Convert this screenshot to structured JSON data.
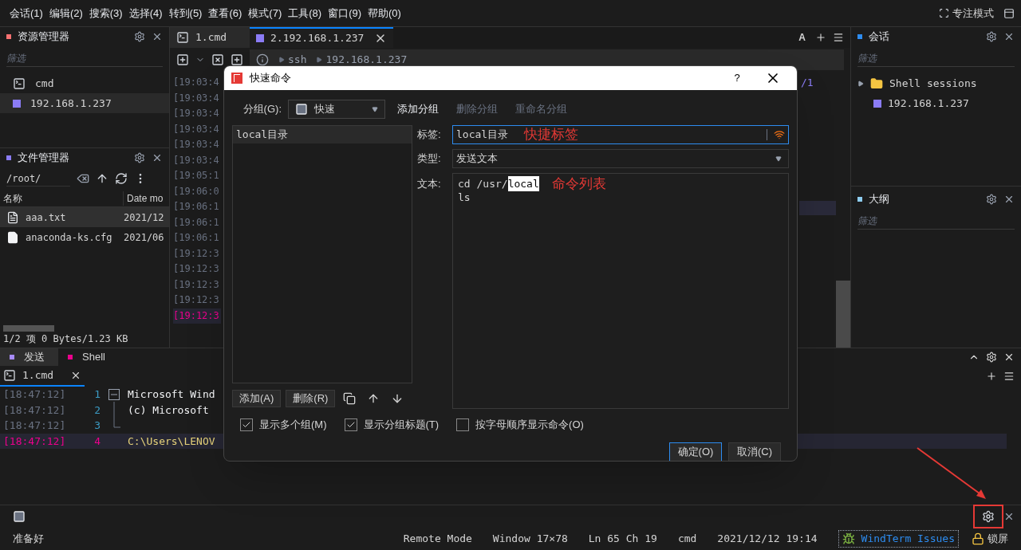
{
  "menu_bar": {
    "items": [
      "会话(1)",
      "编辑(2)",
      "搜索(3)",
      "选择(4)",
      "转到(5)",
      "查看(6)",
      "模式(7)",
      "工具(8)",
      "窗口(9)",
      "帮助(0)"
    ],
    "focus_mode": "专注模式"
  },
  "explorer": {
    "title": "资源管理器",
    "filter_placeholder": "筛选",
    "items": [
      {
        "label": "cmd",
        "kind": "terminal",
        "selected": false
      },
      {
        "label": "192.168.1.237",
        "kind": "ssh",
        "selected": true
      }
    ]
  },
  "file_manager": {
    "title": "文件管理器",
    "path": "/root/",
    "columns": [
      "名称",
      "Date mo"
    ],
    "rows": [
      {
        "name": "aaa.txt",
        "kind": "text",
        "date": "2021/12",
        "selected": true
      },
      {
        "name": "anaconda-ks.cfg",
        "kind": "file",
        "date": "2021/06",
        "selected": false
      }
    ],
    "status": "1/2 项 0 Bytes/1.23 KB"
  },
  "editor_tabs": [
    {
      "label": "1.cmd",
      "kind": "terminal",
      "selected": false
    },
    {
      "label": "2.192.168.1.237",
      "kind": "ssh",
      "selected": true
    }
  ],
  "font_button": "A",
  "breadcrumb": [
    "ssh",
    "192.168.1.237"
  ],
  "terminal_lines": [
    {
      "time": "[19:03:4",
      "highlighted": false
    },
    {
      "time": "[19:03:4",
      "highlighted": false
    },
    {
      "time": "[19:03:4",
      "highlighted": false
    },
    {
      "time": "[19:03:4",
      "highlighted": false
    },
    {
      "time": "[19:03:4",
      "highlighted": false
    },
    {
      "time": "[19:03:4",
      "highlighted": false
    },
    {
      "time": "[19:05:1",
      "highlighted": false
    },
    {
      "time": "[19:06:0",
      "highlighted": false
    },
    {
      "time": "[19:06:1",
      "highlighted": false
    },
    {
      "time": "[19:06:1",
      "highlighted": false
    },
    {
      "time": "[19:06:1",
      "highlighted": false
    },
    {
      "time": "[19:12:3",
      "highlighted": false
    },
    {
      "time": "[19:12:3",
      "highlighted": false
    },
    {
      "time": "[19:12:3",
      "highlighted": false
    },
    {
      "time": "[19:12:3",
      "highlighted": false
    },
    {
      "time": "[19:12:3",
      "highlighted": true
    }
  ],
  "terminal_tail": "/1",
  "sessions": {
    "title": "会话",
    "filter_placeholder": "筛选",
    "items": [
      {
        "label": "Shell sessions",
        "kind": "folder",
        "expanded": false
      },
      {
        "label": "192.168.1.237",
        "kind": "ssh"
      }
    ]
  },
  "outline": {
    "title": "大纲",
    "filter_placeholder": "筛选"
  },
  "bottom_panel": {
    "tabs": [
      {
        "label": "发送",
        "color": "#a78bfa",
        "selected": true
      },
      {
        "label": "Shell",
        "color": "#ec008c",
        "selected": false
      }
    ],
    "sub_tabs": [
      {
        "label": "1.cmd",
        "selected": true
      }
    ],
    "lines": [
      {
        "time": "[18:47:12]",
        "number": "1",
        "text": "Microsoft Wind",
        "kind": "fold_start",
        "highlighted": false
      },
      {
        "time": "[18:47:12]",
        "number": "2",
        "text": "(c) Microsoft",
        "kind": "fold_line",
        "highlighted": false
      },
      {
        "time": "[18:47:12]",
        "number": "3",
        "kind": "fold_end",
        "highlighted": false
      },
      {
        "time": "[18:47:12]",
        "number": "4",
        "text": "C:\\Users\\LENOV",
        "kind": "prompt",
        "highlighted": true
      }
    ]
  },
  "status_bar": {
    "left": "准备好",
    "items": [
      "Remote Mode",
      "Window 17×78",
      "Ln 65 Ch 19",
      "cmd",
      "2021/12/12 19:14"
    ],
    "link": "WindTerm Issues",
    "lock": "锁屏"
  },
  "dialog": {
    "title": "快速命令",
    "help": "?",
    "group_label": "分组(G):",
    "group_value": "快速",
    "group_actions": [
      {
        "label": "添加分组",
        "disabled": false
      },
      {
        "label": "删除分组",
        "disabled": true
      },
      {
        "label": "重命名分组",
        "disabled": true
      }
    ],
    "commands": [
      {
        "label": "local目录",
        "selected": true
      }
    ],
    "tag_label": "标签:",
    "tag_value": "local目录",
    "type_label": "类型:",
    "type_value": "发送文本",
    "text_label": "文本:",
    "text_lines": [
      {
        "segments": [
          {
            "text": "cd /usr/",
            "selected": false
          },
          {
            "text": "local",
            "selected": true
          }
        ]
      },
      {
        "segments": [
          {
            "text": "ls",
            "selected": false
          }
        ]
      }
    ],
    "list_buttons": [
      "添加(A)",
      "删除(R)"
    ],
    "options": [
      {
        "label": "显示多个组(M)",
        "checked": true
      },
      {
        "label": "显示分组标题(T)",
        "checked": true
      },
      {
        "label": "按字母顺序显示命令(O)",
        "checked": false
      }
    ],
    "buttons": [
      {
        "label": "确定(O)",
        "default": true
      },
      {
        "label": "取消(C)",
        "default": false
      }
    ]
  },
  "annotations": [
    {
      "text": "快捷标签"
    },
    {
      "text": "命令列表"
    }
  ]
}
